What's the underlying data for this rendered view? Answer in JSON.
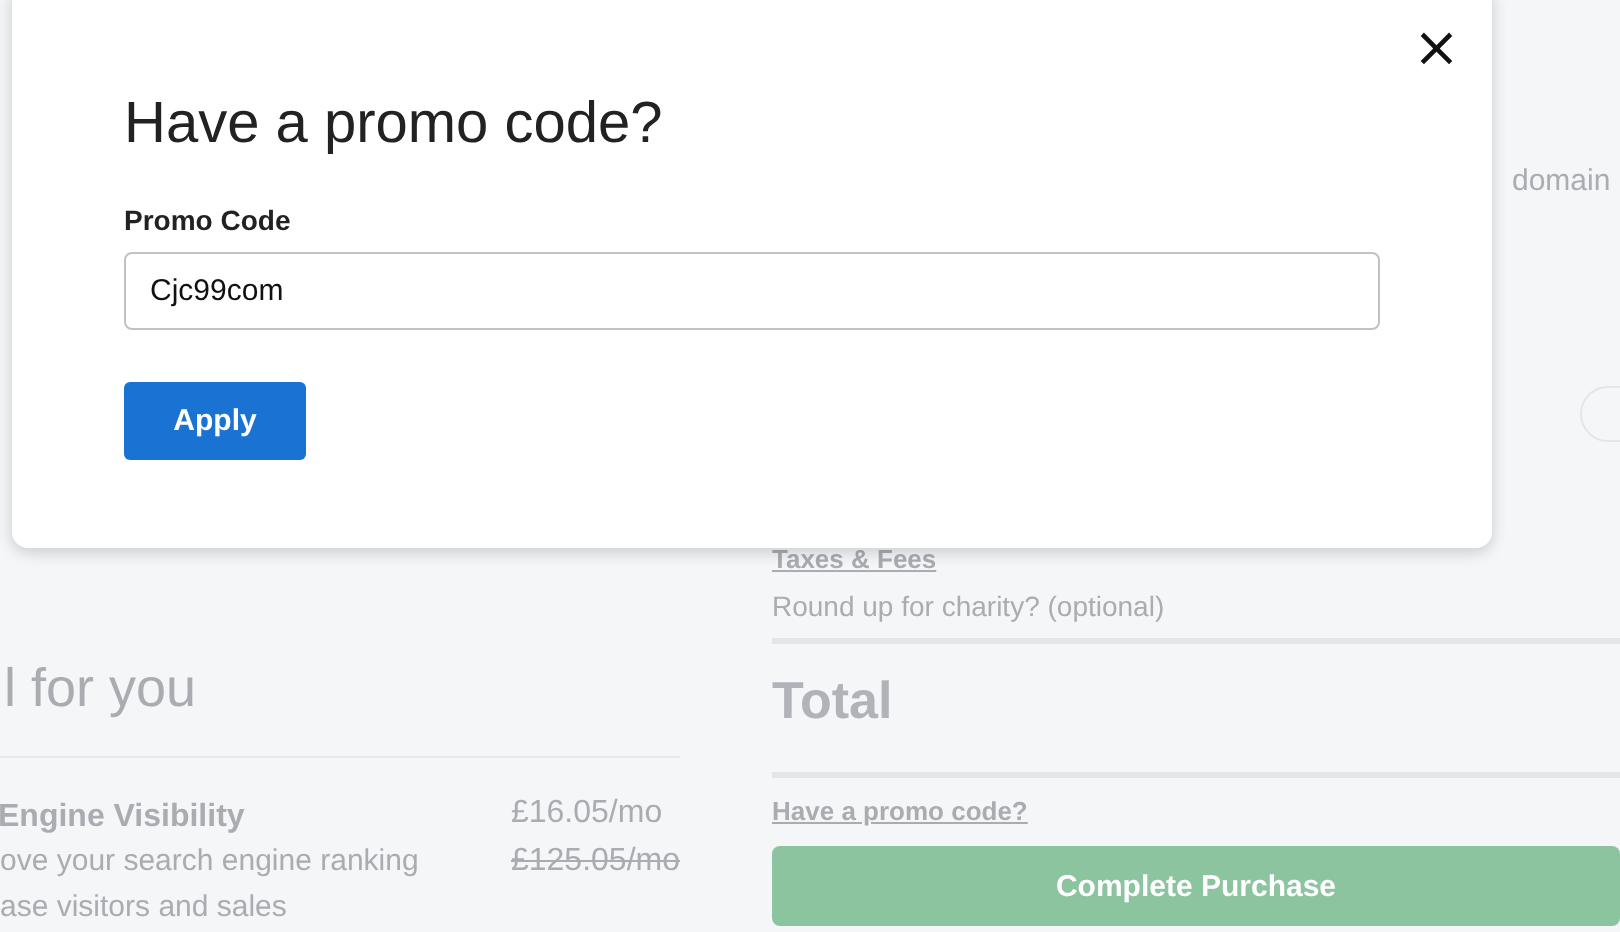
{
  "background_page": {
    "top_right_text": "domain",
    "left": {
      "heading": "l for you",
      "offer": {
        "title": "Engine Visibility",
        "lines": [
          "ove your search engine ranking",
          "ase visitors and sales"
        ],
        "price": "£16.05/mo",
        "old_price": "£125.05/mo"
      }
    },
    "right": {
      "taxes_link": "Taxes & Fees",
      "charity_label": "Round up for charity? (optional)",
      "total_label": "Total",
      "promo_link": "Have a promo code?",
      "purchase_button": {
        "label": "Complete Purchase",
        "disabled": true
      }
    }
  },
  "dialog": {
    "title": "Have a promo code?",
    "close": "×",
    "field": {
      "label": "Promo Code",
      "value": "Cjc99com"
    },
    "apply_button": "Apply"
  }
}
